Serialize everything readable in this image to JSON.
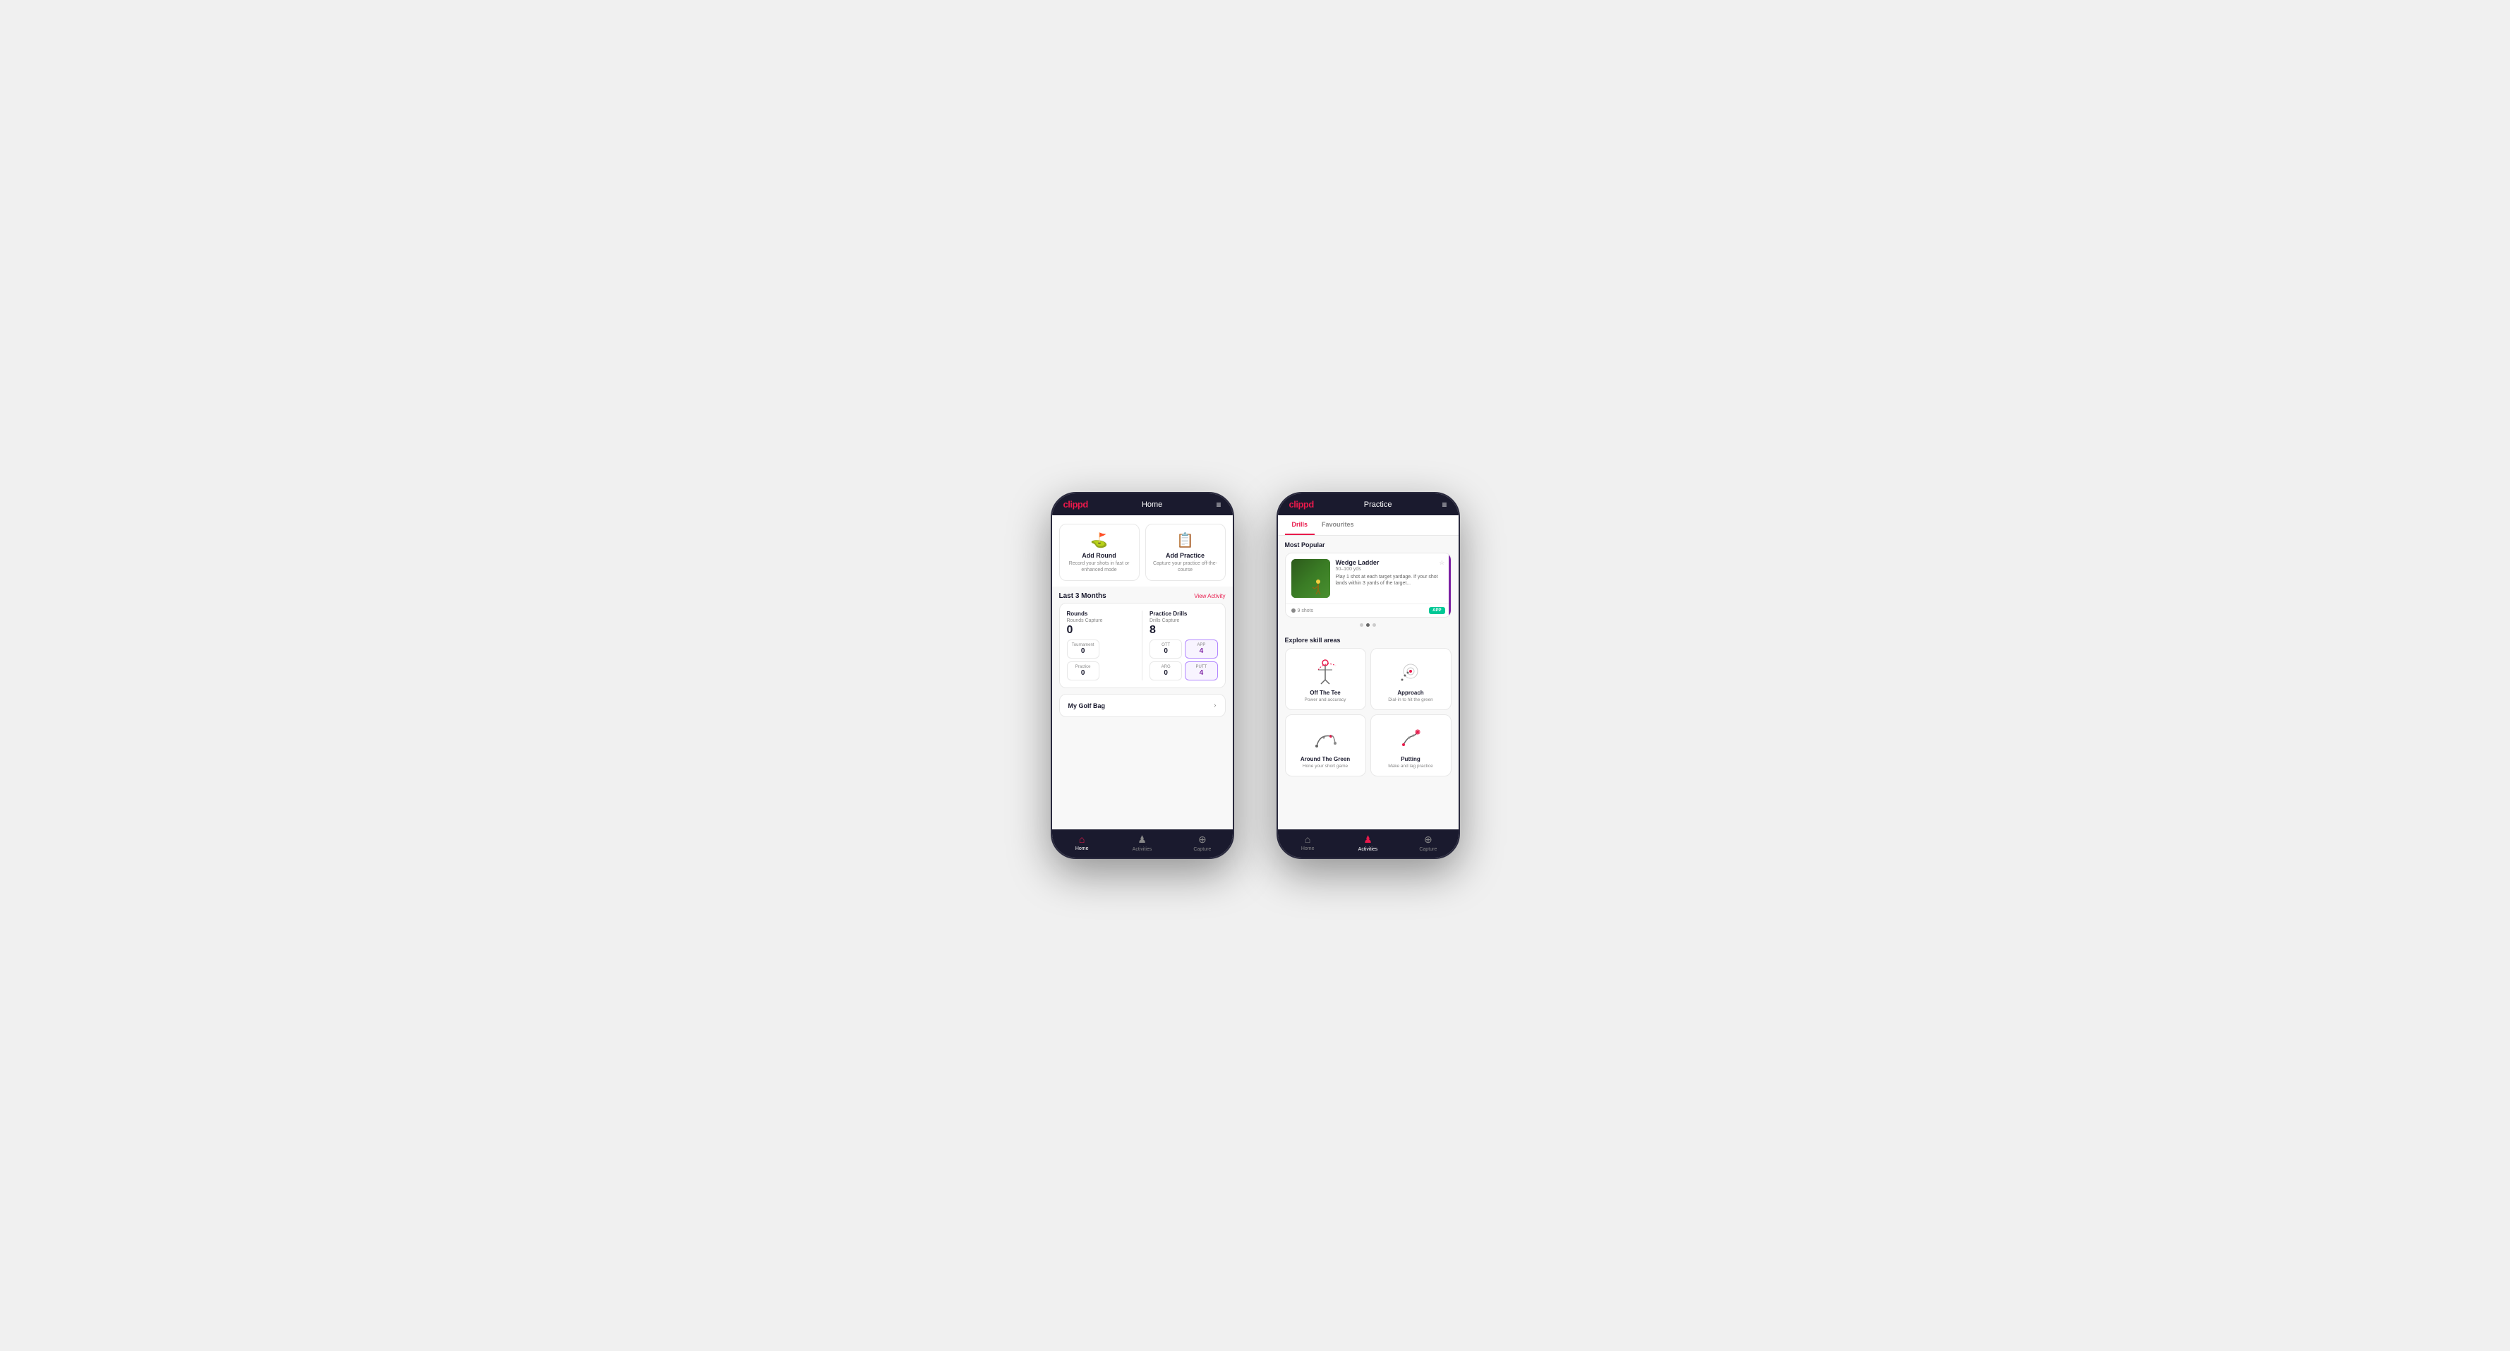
{
  "phone1": {
    "logo": "clippd",
    "title": "Home",
    "menu_icon": "≡",
    "quick_actions": [
      {
        "id": "add-round",
        "icon": "⛳",
        "title": "Add Round",
        "desc": "Record your shots in fast or enhanced mode"
      },
      {
        "id": "add-practice",
        "icon": "📋",
        "title": "Add Practice",
        "desc": "Capture your practice off-the-course"
      }
    ],
    "activity_section": {
      "title": "Last 3 Months",
      "link": "View Activity"
    },
    "rounds": {
      "title": "Rounds",
      "capture_label": "Rounds Capture",
      "total": "0",
      "tournament_label": "Tournament",
      "tournament_value": "0",
      "practice_label": "Practice",
      "practice_value": "0"
    },
    "practice_drills": {
      "title": "Practice Drills",
      "capture_label": "Drills Capture",
      "total": "8",
      "ott_label": "OTT",
      "ott_value": "0",
      "app_label": "APP",
      "app_value": "4",
      "arg_label": "ARG",
      "arg_value": "0",
      "putt_label": "PUTT",
      "putt_value": "4"
    },
    "golf_bag": {
      "label": "My Golf Bag"
    },
    "nav": [
      {
        "id": "home",
        "icon": "🏠",
        "label": "Home",
        "active": true
      },
      {
        "id": "activities",
        "icon": "🏌️",
        "label": "Activities",
        "active": false
      },
      {
        "id": "capture",
        "icon": "➕",
        "label": "Capture",
        "active": false
      }
    ]
  },
  "phone2": {
    "logo": "clippd",
    "title": "Practice",
    "menu_icon": "≡",
    "tabs": [
      {
        "id": "drills",
        "label": "Drills",
        "active": true
      },
      {
        "id": "favourites",
        "label": "Favourites",
        "active": false
      }
    ],
    "most_popular": {
      "title": "Most Popular",
      "drill": {
        "name": "Wedge Ladder",
        "subtitle": "50–100 yds",
        "desc": "Play 1 shot at each target yardage. If your shot lands within 3 yards of the target...",
        "shots": "9 shots",
        "badge": "APP"
      }
    },
    "dots": [
      {
        "active": false
      },
      {
        "active": true
      },
      {
        "active": false
      }
    ],
    "explore": {
      "title": "Explore skill areas",
      "skills": [
        {
          "id": "off-the-tee",
          "name": "Off The Tee",
          "desc": "Power and accuracy"
        },
        {
          "id": "approach",
          "name": "Approach",
          "desc": "Dial-in to hit the green"
        },
        {
          "id": "around-the-green",
          "name": "Around The Green",
          "desc": "Hone your short game"
        },
        {
          "id": "putting",
          "name": "Putting",
          "desc": "Make and lag practice"
        }
      ]
    },
    "nav": [
      {
        "id": "home",
        "icon": "🏠",
        "label": "Home",
        "active": false
      },
      {
        "id": "activities",
        "icon": "🏌️",
        "label": "Activities",
        "active": true
      },
      {
        "id": "capture",
        "icon": "➕",
        "label": "Capture",
        "active": false
      }
    ]
  }
}
